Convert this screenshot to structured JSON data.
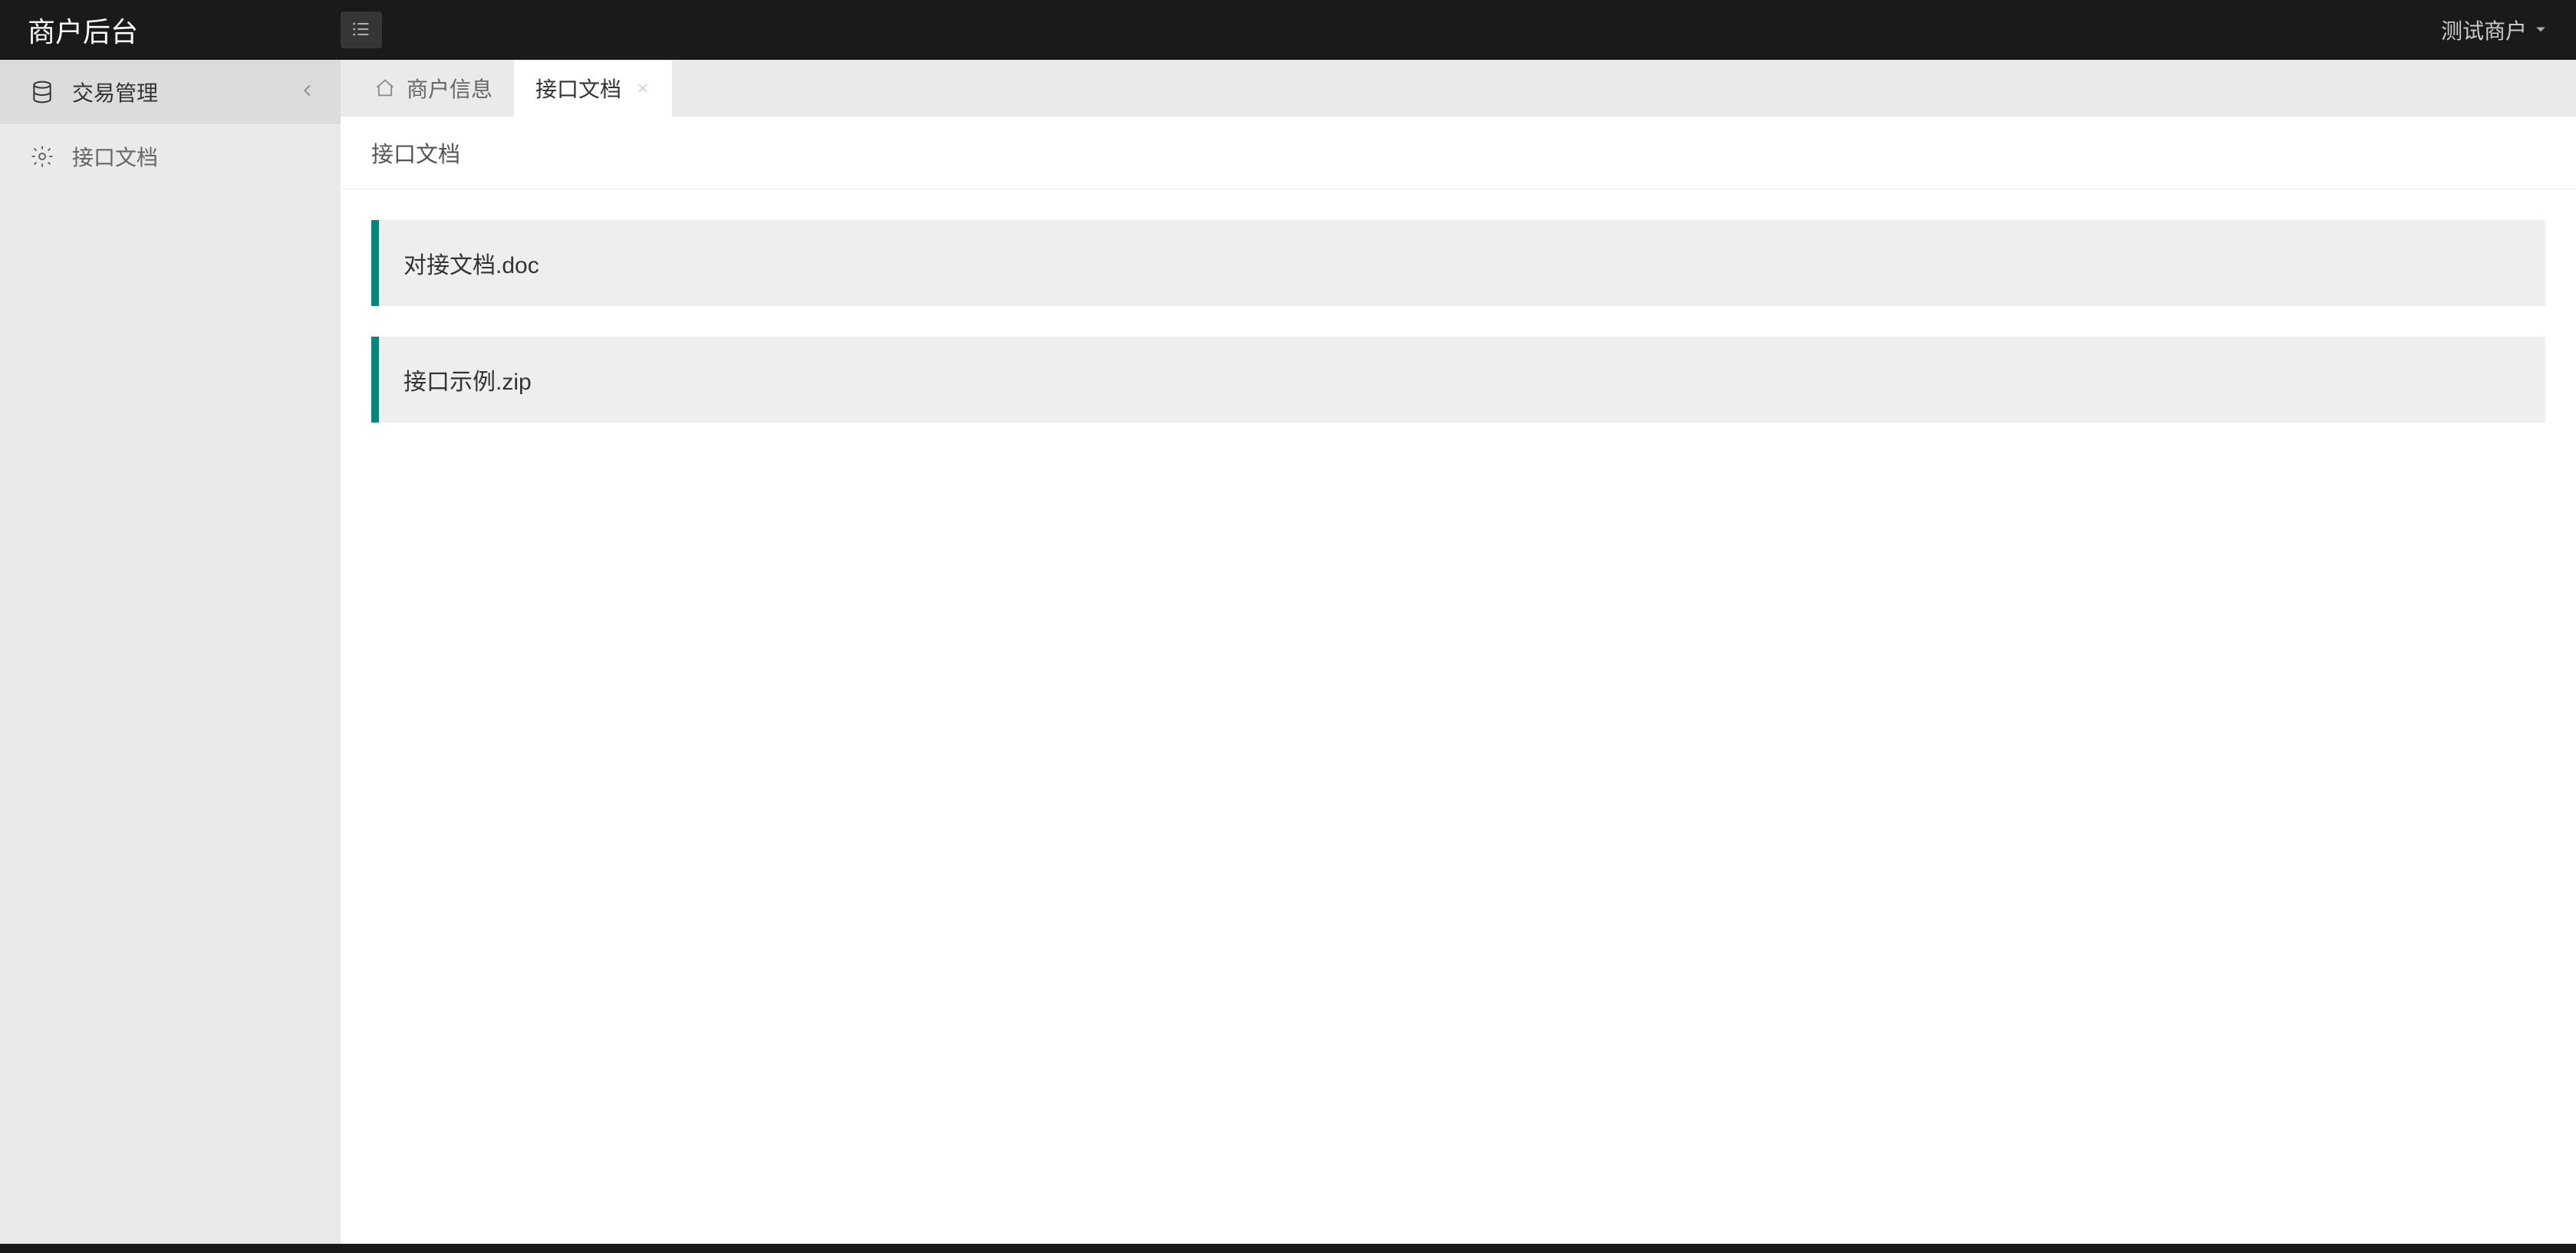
{
  "header": {
    "brand": "商户后台",
    "user_label": "测试商户"
  },
  "sidebar": {
    "items": [
      {
        "label": "交易管理",
        "icon": "database",
        "has_submenu": true,
        "active": true
      },
      {
        "label": "接口文档",
        "icon": "gear",
        "has_submenu": false,
        "active": false
      }
    ]
  },
  "tabs": [
    {
      "label": "商户信息",
      "icon": "home",
      "closable": false,
      "active": false
    },
    {
      "label": "接口文档",
      "icon": null,
      "closable": true,
      "active": true
    }
  ],
  "page": {
    "title": "接口文档",
    "files": [
      {
        "name": "对接文档.doc"
      },
      {
        "name": "接口示例.zip"
      }
    ]
  },
  "colors": {
    "accent": "#00897b",
    "header_bg": "#1a1a1a",
    "sidebar_bg": "#eaeaea",
    "file_bg": "#eeeeee"
  }
}
